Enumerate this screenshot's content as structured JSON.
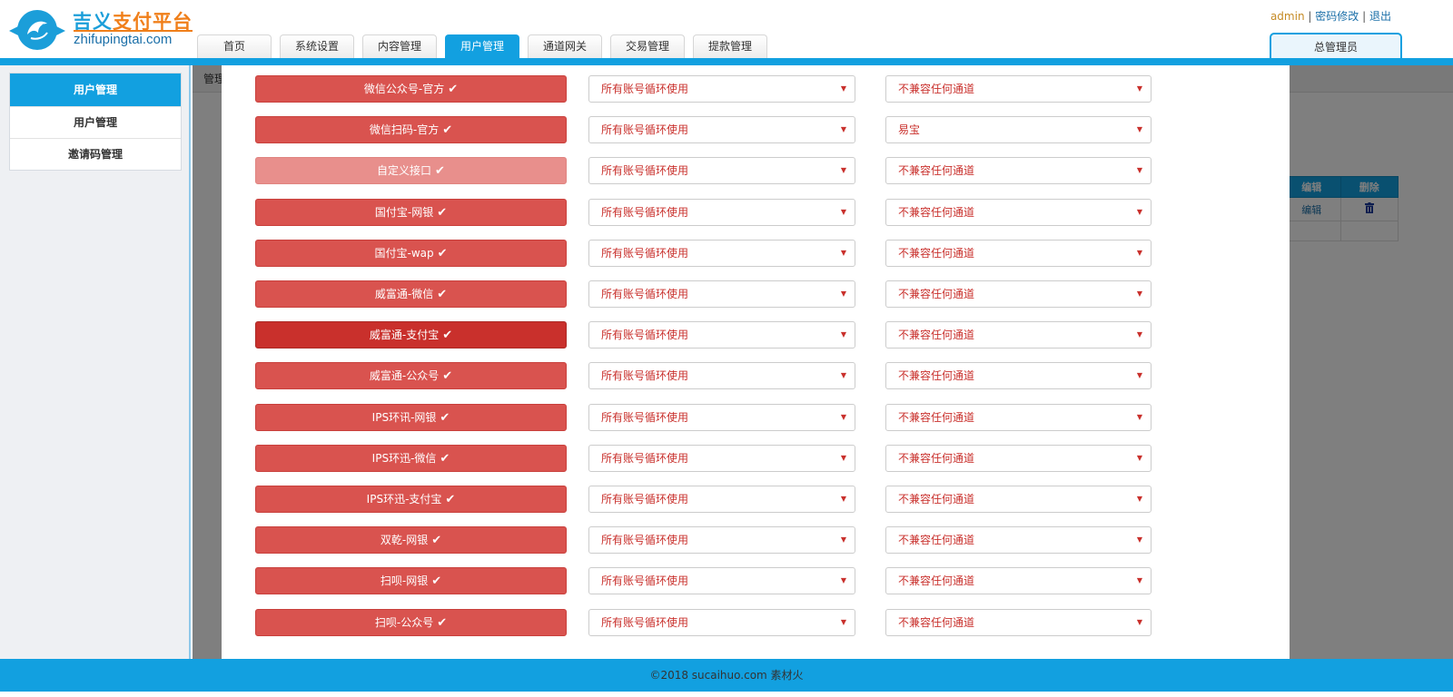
{
  "brand": {
    "name_part1": "吉义",
    "name_part2": "支付平台",
    "domain": "zhifupingtai.com"
  },
  "nav": {
    "tabs": [
      {
        "label": "首页"
      },
      {
        "label": "系统设置"
      },
      {
        "label": "内容管理"
      },
      {
        "label": "用户管理",
        "active": true
      },
      {
        "label": "通道网关"
      },
      {
        "label": "交易管理"
      },
      {
        "label": "提款管理"
      }
    ]
  },
  "user": {
    "name": "admin",
    "separator": "|",
    "change_password": "密码修改",
    "logout": "退出",
    "role": "总管理员"
  },
  "sidebar": {
    "heading": "用户管理",
    "items": [
      {
        "label": "用户管理"
      },
      {
        "label": "邀请码管理"
      }
    ]
  },
  "main": {
    "breadcrumb": "管理",
    "table": {
      "headers": [
        "编辑",
        "删除"
      ],
      "rows": [
        {
          "edit": "编辑"
        }
      ]
    }
  },
  "modal": {
    "check_glyph": "✔",
    "caret_glyph": "▼",
    "rows": [
      {
        "channel": "微信公众号-官方",
        "account_mode": "所有账号循环使用",
        "compat": "不兼容任何通道",
        "style": "normal"
      },
      {
        "channel": "微信扫码-官方",
        "account_mode": "所有账号循环使用",
        "compat": "易宝",
        "style": "normal"
      },
      {
        "channel": "自定义接口",
        "account_mode": "所有账号循环使用",
        "compat": "不兼容任何通道",
        "style": "light"
      },
      {
        "channel": "国付宝-网银",
        "account_mode": "所有账号循环使用",
        "compat": "不兼容任何通道",
        "style": "normal"
      },
      {
        "channel": "国付宝-wap",
        "account_mode": "所有账号循环使用",
        "compat": "不兼容任何通道",
        "style": "normal"
      },
      {
        "channel": "威富通-微信",
        "account_mode": "所有账号循环使用",
        "compat": "不兼容任何通道",
        "style": "normal"
      },
      {
        "channel": "威富通-支付宝",
        "account_mode": "所有账号循环使用",
        "compat": "不兼容任何通道",
        "style": "dark"
      },
      {
        "channel": "威富通-公众号",
        "account_mode": "所有账号循环使用",
        "compat": "不兼容任何通道",
        "style": "normal"
      },
      {
        "channel": "IPS环讯-网银",
        "account_mode": "所有账号循环使用",
        "compat": "不兼容任何通道",
        "style": "normal"
      },
      {
        "channel": "IPS环迅-微信",
        "account_mode": "所有账号循环使用",
        "compat": "不兼容任何通道",
        "style": "normal"
      },
      {
        "channel": "IPS环迅-支付宝",
        "account_mode": "所有账号循环使用",
        "compat": "不兼容任何通道",
        "style": "normal"
      },
      {
        "channel": "双乾-网银",
        "account_mode": "所有账号循环使用",
        "compat": "不兼容任何通道",
        "style": "normal"
      },
      {
        "channel": "扫呗-网银",
        "account_mode": "所有账号循环使用",
        "compat": "不兼容任何通道",
        "style": "normal"
      },
      {
        "channel": "扫呗-公众号",
        "account_mode": "所有账号循环使用",
        "compat": "不兼容任何通道",
        "style": "normal"
      }
    ]
  },
  "footer": {
    "copyright": "©2018 sucaihuo.com 素材火"
  },
  "colors": {
    "primary": "#12a0e0",
    "channel_button": "#d9534f",
    "channel_button_light": "#e88f8c",
    "channel_button_dark": "#c9302c",
    "select_text": "#c9302c",
    "brand_blue": "#1b9ed9",
    "brand_orange": "#f07f1a"
  },
  "icons": {
    "logo": "dolphin-logo-icon",
    "check": "check-icon",
    "caret": "caret-down-icon",
    "trash": "trash-icon"
  }
}
